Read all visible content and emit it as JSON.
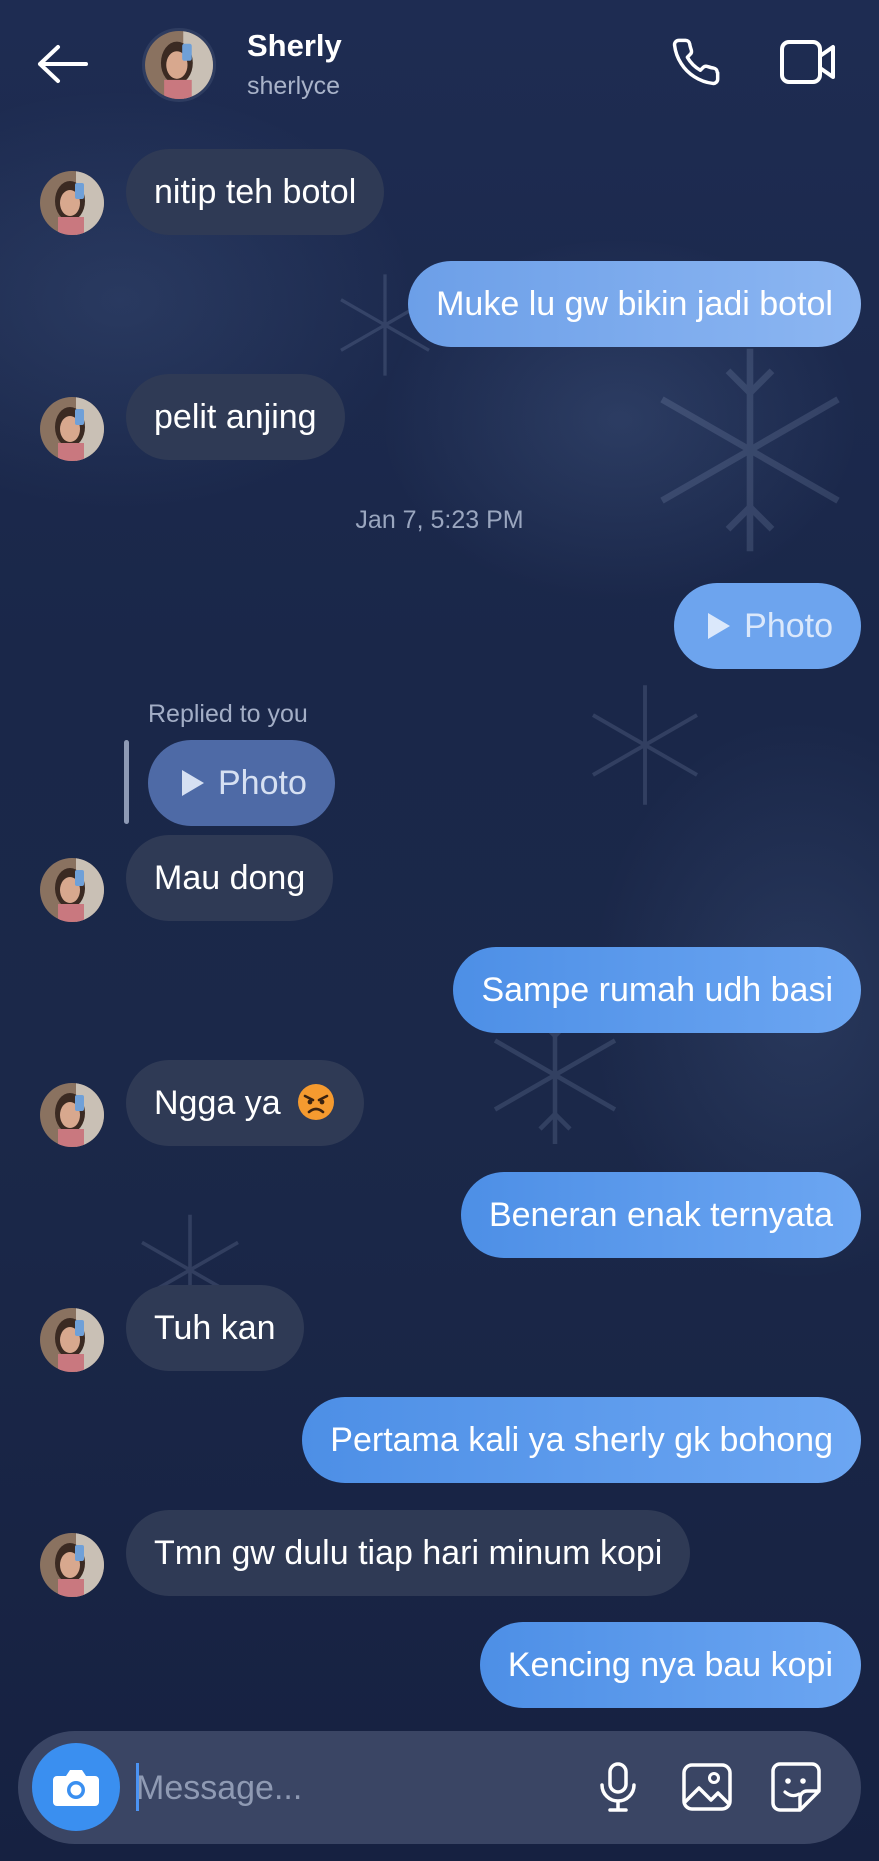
{
  "header": {
    "name": "Sherly",
    "username": "sherlyce"
  },
  "messages": [
    {
      "side": "in",
      "text": "nitip teh botol"
    },
    {
      "side": "out",
      "text": "Muke lu gw bikin jadi botol"
    },
    {
      "side": "in",
      "text": "pelit anjing"
    },
    {
      "side": "out",
      "text": "Photo"
    },
    {
      "side": "in",
      "text": "Photo"
    },
    {
      "side": "in",
      "text": "Mau dong"
    },
    {
      "side": "out",
      "text": "Sampe rumah udh basi"
    },
    {
      "side": "in",
      "text": "Ngga ya"
    },
    {
      "side": "out",
      "text": "Beneran enak ternyata"
    },
    {
      "side": "in",
      "text": "Tuh kan"
    },
    {
      "side": "out",
      "text": "Pertama kali ya sherly gk bohong"
    },
    {
      "side": "in",
      "text": "Tmn gw dulu tiap hari minum kopi"
    },
    {
      "side": "out",
      "text": "Kencing nya bau kopi"
    }
  ],
  "timestamp": "Jan 7, 5:23 PM",
  "reply_label": "Replied to you",
  "composer": {
    "placeholder": "Message..."
  },
  "icons": {
    "back": "arrow-left-icon",
    "call": "phone-icon",
    "video": "video-camera-icon",
    "camera": "camera-icon",
    "mic": "microphone-icon",
    "gallery": "image-icon",
    "sticker": "sticker-icon",
    "emoji": "angry-face-emoji"
  },
  "colors": {
    "outgoing_bubble": "#5b9aec",
    "incoming_bubble": "#2f3a55",
    "camera_button": "#3a8ff0",
    "background": "#1b2849"
  }
}
